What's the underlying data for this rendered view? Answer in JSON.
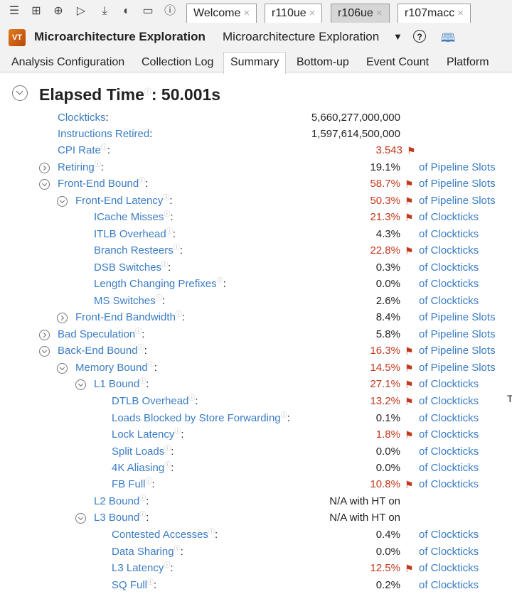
{
  "toolbar": {
    "tabs": [
      {
        "label": "Welcome",
        "close": "×"
      },
      {
        "label": "r110ue",
        "close": "×"
      },
      {
        "label": "r106ue",
        "close": "×"
      },
      {
        "label": "r107macc",
        "close": "×"
      }
    ],
    "icons": [
      "menu-icon",
      "new-project-icon",
      "new-analysis-icon",
      "run-icon",
      "import-icon",
      "compare-icon",
      "open-icon",
      "help-icon"
    ]
  },
  "titlebar": {
    "logo_text": "VT",
    "title": "Microarchitecture Exploration",
    "analysis_name": "Microarchitecture Exploration",
    "help": "?"
  },
  "view_tabs": [
    "Analysis Configuration",
    "Collection Log",
    "Summary",
    "Bottom-up",
    "Event Count",
    "Platform"
  ],
  "summary": {
    "elapsed_label": "Elapsed Time",
    "elapsed_value": ": 50.001s",
    "rows": [
      {
        "label": "Clockticks",
        "value": "5,660,277,000,000",
        "unit": "",
        "flag": false,
        "toggle": "none",
        "info": false
      },
      {
        "label": "Instructions Retired",
        "value": "1,597,614,500,000",
        "unit": "",
        "flag": false,
        "toggle": "none",
        "info": false
      },
      {
        "label": "CPI Rate",
        "value": "3.543",
        "unit": "",
        "flag": true,
        "toggle": "none",
        "info": true
      },
      {
        "label": "Retiring",
        "value": "19.1%",
        "unit": "of Pipeline Slots",
        "flag": false,
        "toggle": "closed",
        "info": true
      },
      {
        "label": "Front-End Bound",
        "value": "58.7%",
        "unit": "of Pipeline Slots",
        "flag": true,
        "toggle": "open",
        "info": true
      },
      {
        "label": "Front-End Latency",
        "value": "50.3%",
        "unit": "of Pipeline Slots",
        "flag": true,
        "toggle": "open",
        "info": true
      },
      {
        "label": "ICache Misses",
        "value": "21.3%",
        "unit": "of Clockticks",
        "flag": true,
        "toggle": "none",
        "info": true
      },
      {
        "label": "ITLB Overhead",
        "value": "4.3%",
        "unit": "of Clockticks",
        "flag": false,
        "toggle": "none",
        "info": true
      },
      {
        "label": "Branch Resteers",
        "value": "22.8%",
        "unit": "of Clockticks",
        "flag": true,
        "toggle": "none",
        "info": true
      },
      {
        "label": "DSB Switches",
        "value": "0.3%",
        "unit": "of Clockticks",
        "flag": false,
        "toggle": "none",
        "info": true
      },
      {
        "label": "Length Changing Prefixes",
        "value": "0.0%",
        "unit": "of Clockticks",
        "flag": false,
        "toggle": "none",
        "info": true
      },
      {
        "label": "MS Switches",
        "value": "2.6%",
        "unit": "of Clockticks",
        "flag": false,
        "toggle": "none",
        "info": true
      },
      {
        "label": "Front-End Bandwidth",
        "value": "8.4%",
        "unit": "of Pipeline Slots",
        "flag": false,
        "toggle": "closed",
        "info": true
      },
      {
        "label": "Bad Speculation",
        "value": "5.8%",
        "unit": "of Pipeline Slots",
        "flag": false,
        "toggle": "closed",
        "info": true
      },
      {
        "label": "Back-End Bound",
        "value": "16.3%",
        "unit": "of Pipeline Slots",
        "flag": true,
        "toggle": "open",
        "info": true
      },
      {
        "label": "Memory Bound",
        "value": "14.5%",
        "unit": "of Pipeline Slots",
        "flag": true,
        "toggle": "open",
        "info": true
      },
      {
        "label": "L1 Bound",
        "value": "27.1%",
        "unit": "of Clockticks",
        "flag": true,
        "toggle": "open",
        "info": true
      },
      {
        "label": "DTLB Overhead",
        "value": "13.2%",
        "unit": "of Clockticks",
        "flag": true,
        "toggle": "none",
        "info": true
      },
      {
        "label": "Loads Blocked by Store Forwarding",
        "value": "0.1%",
        "unit": "of Clockticks",
        "flag": false,
        "toggle": "none",
        "info": true
      },
      {
        "label": "Lock Latency",
        "value": "1.8%",
        "unit": "of Clockticks",
        "flag": true,
        "toggle": "none",
        "info": true
      },
      {
        "label": "Split Loads",
        "value": "0.0%",
        "unit": "of Clockticks",
        "flag": false,
        "toggle": "none",
        "info": true
      },
      {
        "label": "4K Aliasing",
        "value": "0.0%",
        "unit": "of Clockticks",
        "flag": false,
        "toggle": "none",
        "info": true
      },
      {
        "label": "FB Full",
        "value": "10.8%",
        "unit": "of Clockticks",
        "flag": true,
        "toggle": "none",
        "info": true
      },
      {
        "label": "L2 Bound",
        "value": "N/A with HT on",
        "unit": "",
        "flag": false,
        "toggle": "none",
        "info": true
      },
      {
        "label": "L3 Bound",
        "value": "N/A with HT on",
        "unit": "",
        "flag": false,
        "toggle": "open",
        "info": true
      },
      {
        "label": "Contested Accesses",
        "value": "0.4%",
        "unit": "of Clockticks",
        "flag": false,
        "toggle": "none",
        "info": true
      },
      {
        "label": "Data Sharing",
        "value": "0.0%",
        "unit": "of Clockticks",
        "flag": false,
        "toggle": "none",
        "info": true
      },
      {
        "label": "L3 Latency",
        "value": "12.5%",
        "unit": "of Clockticks",
        "flag": true,
        "toggle": "none",
        "info": true
      },
      {
        "label": "SQ Full",
        "value": "0.2%",
        "unit": "of Clockticks",
        "flag": false,
        "toggle": "none",
        "info": true
      }
    ],
    "edge_text": "T"
  },
  "colors": {
    "link": "#3a7cc4",
    "hot": "#c0391b",
    "chrome": "#f2f2f2",
    "active_doc_tab": "#d6d6d6"
  }
}
